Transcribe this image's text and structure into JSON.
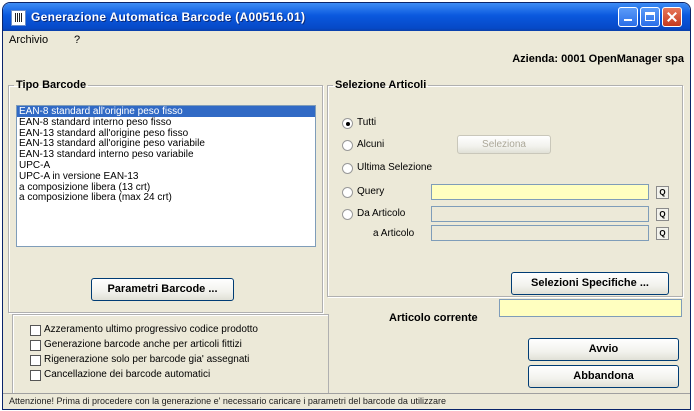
{
  "window": {
    "title": "Generazione Automatica Barcode  (A00516.01)"
  },
  "menu": [
    "Archivio",
    "?"
  ],
  "azienda": "Azienda: 0001 OpenManager spa",
  "tipo_barcode": {
    "legend": "Tipo Barcode",
    "items": [
      "EAN-8  standard all'origine peso fisso",
      "EAN-8  standard interno    peso fisso",
      "EAN-13 standard all'origine peso fisso",
      "EAN-13 standard all'origine peso variabile",
      "EAN-13 standard interno    peso variabile",
      "UPC-A",
      "UPC-A  in versione EAN-13",
      "a composizione libera (13 crt)",
      "a composizione libera (max 24 crt)"
    ],
    "selected_index": 0,
    "parametri_button": "Parametri Barcode ..."
  },
  "selezione_articoli": {
    "legend": "Selezione Articoli",
    "options": [
      "Tutti",
      "Alcuni",
      "Ultima Selezione",
      "Query",
      "Da  Articolo"
    ],
    "selected_index": 0,
    "seleziona_button": "Seleziona",
    "a_articolo_label": "a  Articolo",
    "selezioni_specifiche_button": "Selezioni Specifiche ...",
    "lookup_icon": "search-icon"
  },
  "articolo_corrente": {
    "label": "Articolo corrente",
    "value": ""
  },
  "options": [
    {
      "label": "Azzeramento ultimo progressivo codice prodotto",
      "checked": false
    },
    {
      "label": "Generazione barcode anche per articoli fittizi",
      "checked": false
    },
    {
      "label": "Rigenerazione solo per barcode gia' assegnati",
      "checked": false
    },
    {
      "label": "Cancellazione dei barcode automatici",
      "checked": false
    }
  ],
  "buttons": {
    "avvio": "Avvio",
    "abbandona": "Abbandona"
  },
  "status": "Attenzione! Prima di procedere con la generazione e' necessario caricare i parametri del barcode da utilizzare",
  "colors": {
    "titlebar": "#0a58de",
    "selection": "#316ac5",
    "field_yellow": "#ffffc0"
  }
}
